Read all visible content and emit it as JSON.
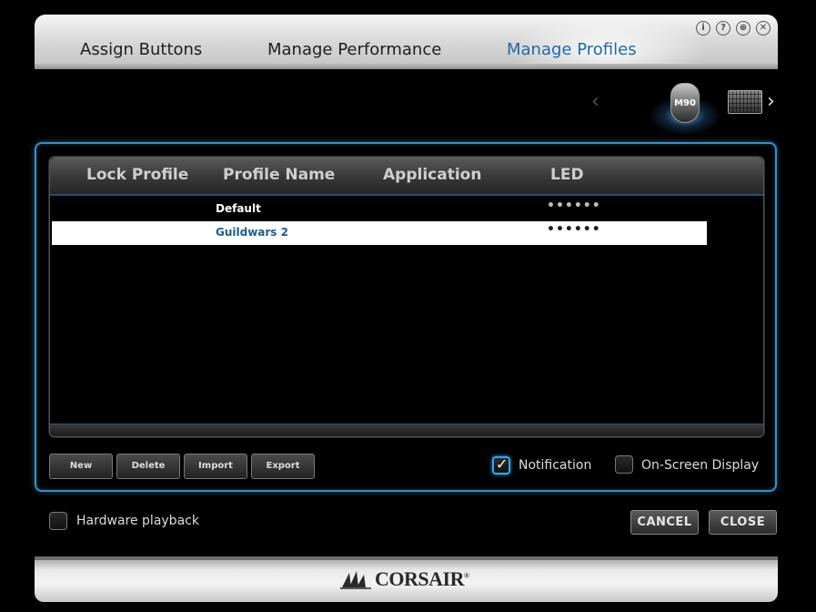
{
  "tabs": [
    {
      "label": "Assign Buttons",
      "active": false
    },
    {
      "label": "Manage Performance",
      "active": false
    },
    {
      "label": "Manage Profiles",
      "active": true
    }
  ],
  "window_buttons": {
    "info": "i",
    "help": "?",
    "web": "⊕",
    "close": "✕"
  },
  "devices": {
    "selected": "M90",
    "items": [
      "mouse-icon",
      "keyboard-icon"
    ]
  },
  "table": {
    "columns": [
      "Lock Profile",
      "Profile Name",
      "Application",
      "LED"
    ],
    "rows": [
      {
        "profile_name": "Default",
        "led": "••••••",
        "selected": false
      },
      {
        "profile_name": "Guildwars 2",
        "led": "••••••",
        "selected": true
      }
    ]
  },
  "actions": {
    "new": "New",
    "delete": "Delete",
    "import": "Import",
    "export": "Export"
  },
  "options": {
    "notification": {
      "label": "Notification",
      "checked": true
    },
    "osd": {
      "label": "On-Screen Display",
      "checked": false
    },
    "hardware_playback": {
      "label": "Hardware playback",
      "checked": false
    }
  },
  "dialog": {
    "cancel": "CANCEL",
    "close": "CLOSE"
  },
  "brand": {
    "logo_text": "CORSAIR",
    "registered": "®"
  },
  "colors": {
    "accent": "#3a8fc4",
    "active_tab": "#1f6aa8",
    "selected_text": "#1d5d8f"
  }
}
